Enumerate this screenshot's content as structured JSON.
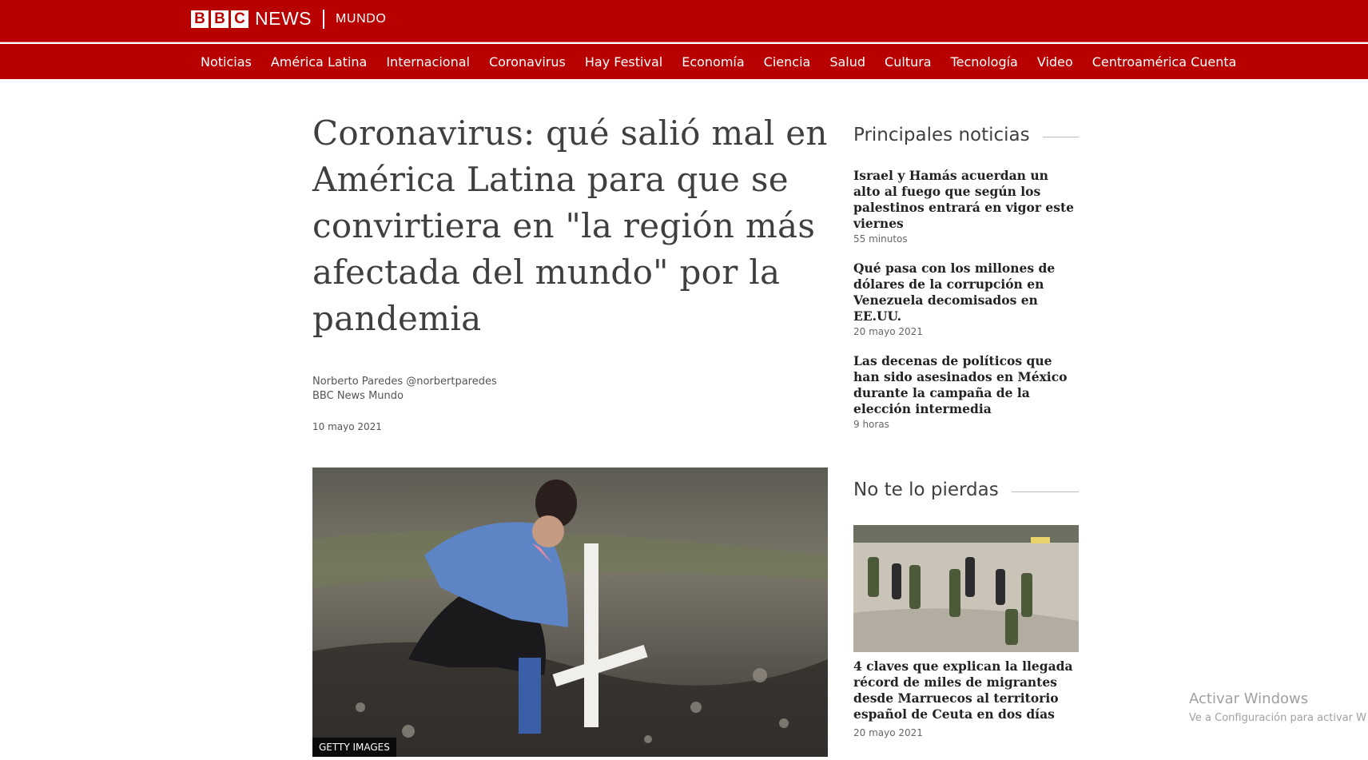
{
  "brand": {
    "blocks": [
      "B",
      "B",
      "C"
    ],
    "news": "NEWS",
    "edition": "MUNDO"
  },
  "nav": {
    "items": [
      "Noticias",
      "América Latina",
      "Internacional",
      "Coronavirus",
      "Hay Festival",
      "Economía",
      "Ciencia",
      "Salud",
      "Cultura",
      "Tecnología",
      "Video",
      "Centroamérica Cuenta"
    ]
  },
  "article": {
    "headline": "Coronavirus: qué salió mal en América Latina para que se convirtiera en \"la región más afectada del mundo\" por la pandemia",
    "author": "Norberto Paredes @norbertparedes",
    "outlet": "BBC News Mundo",
    "date": "10 mayo 2021",
    "image_credit": "GETTY IMAGES"
  },
  "top_stories": {
    "heading": "Principales noticias",
    "items": [
      {
        "title": "Israel y Hamás acuerdan un alto al fuego que según los palestinos entrará en vigor este viernes",
        "time": "55 minutos"
      },
      {
        "title": "Qué pasa con los millones de dólares de la corrupción en Venezuela decomisados en EE.UU.",
        "time": "20 mayo 2021"
      },
      {
        "title": "Las decenas de políticos que han sido asesinados en México durante la campaña de la elección intermedia",
        "time": "9 horas"
      }
    ]
  },
  "dont_miss": {
    "heading": "No te lo pierdas",
    "title": "4 claves que explican la llegada récord de miles de migrantes desde Marruecos al territorio español de Ceuta en dos días",
    "time": "20 mayo 2021"
  },
  "windows_watermark": {
    "line1": "Activar Windows",
    "line2": "Ve a Configuración para activar W"
  },
  "colors": {
    "brand_red": "#b80000",
    "headline": "#3f3f42"
  }
}
